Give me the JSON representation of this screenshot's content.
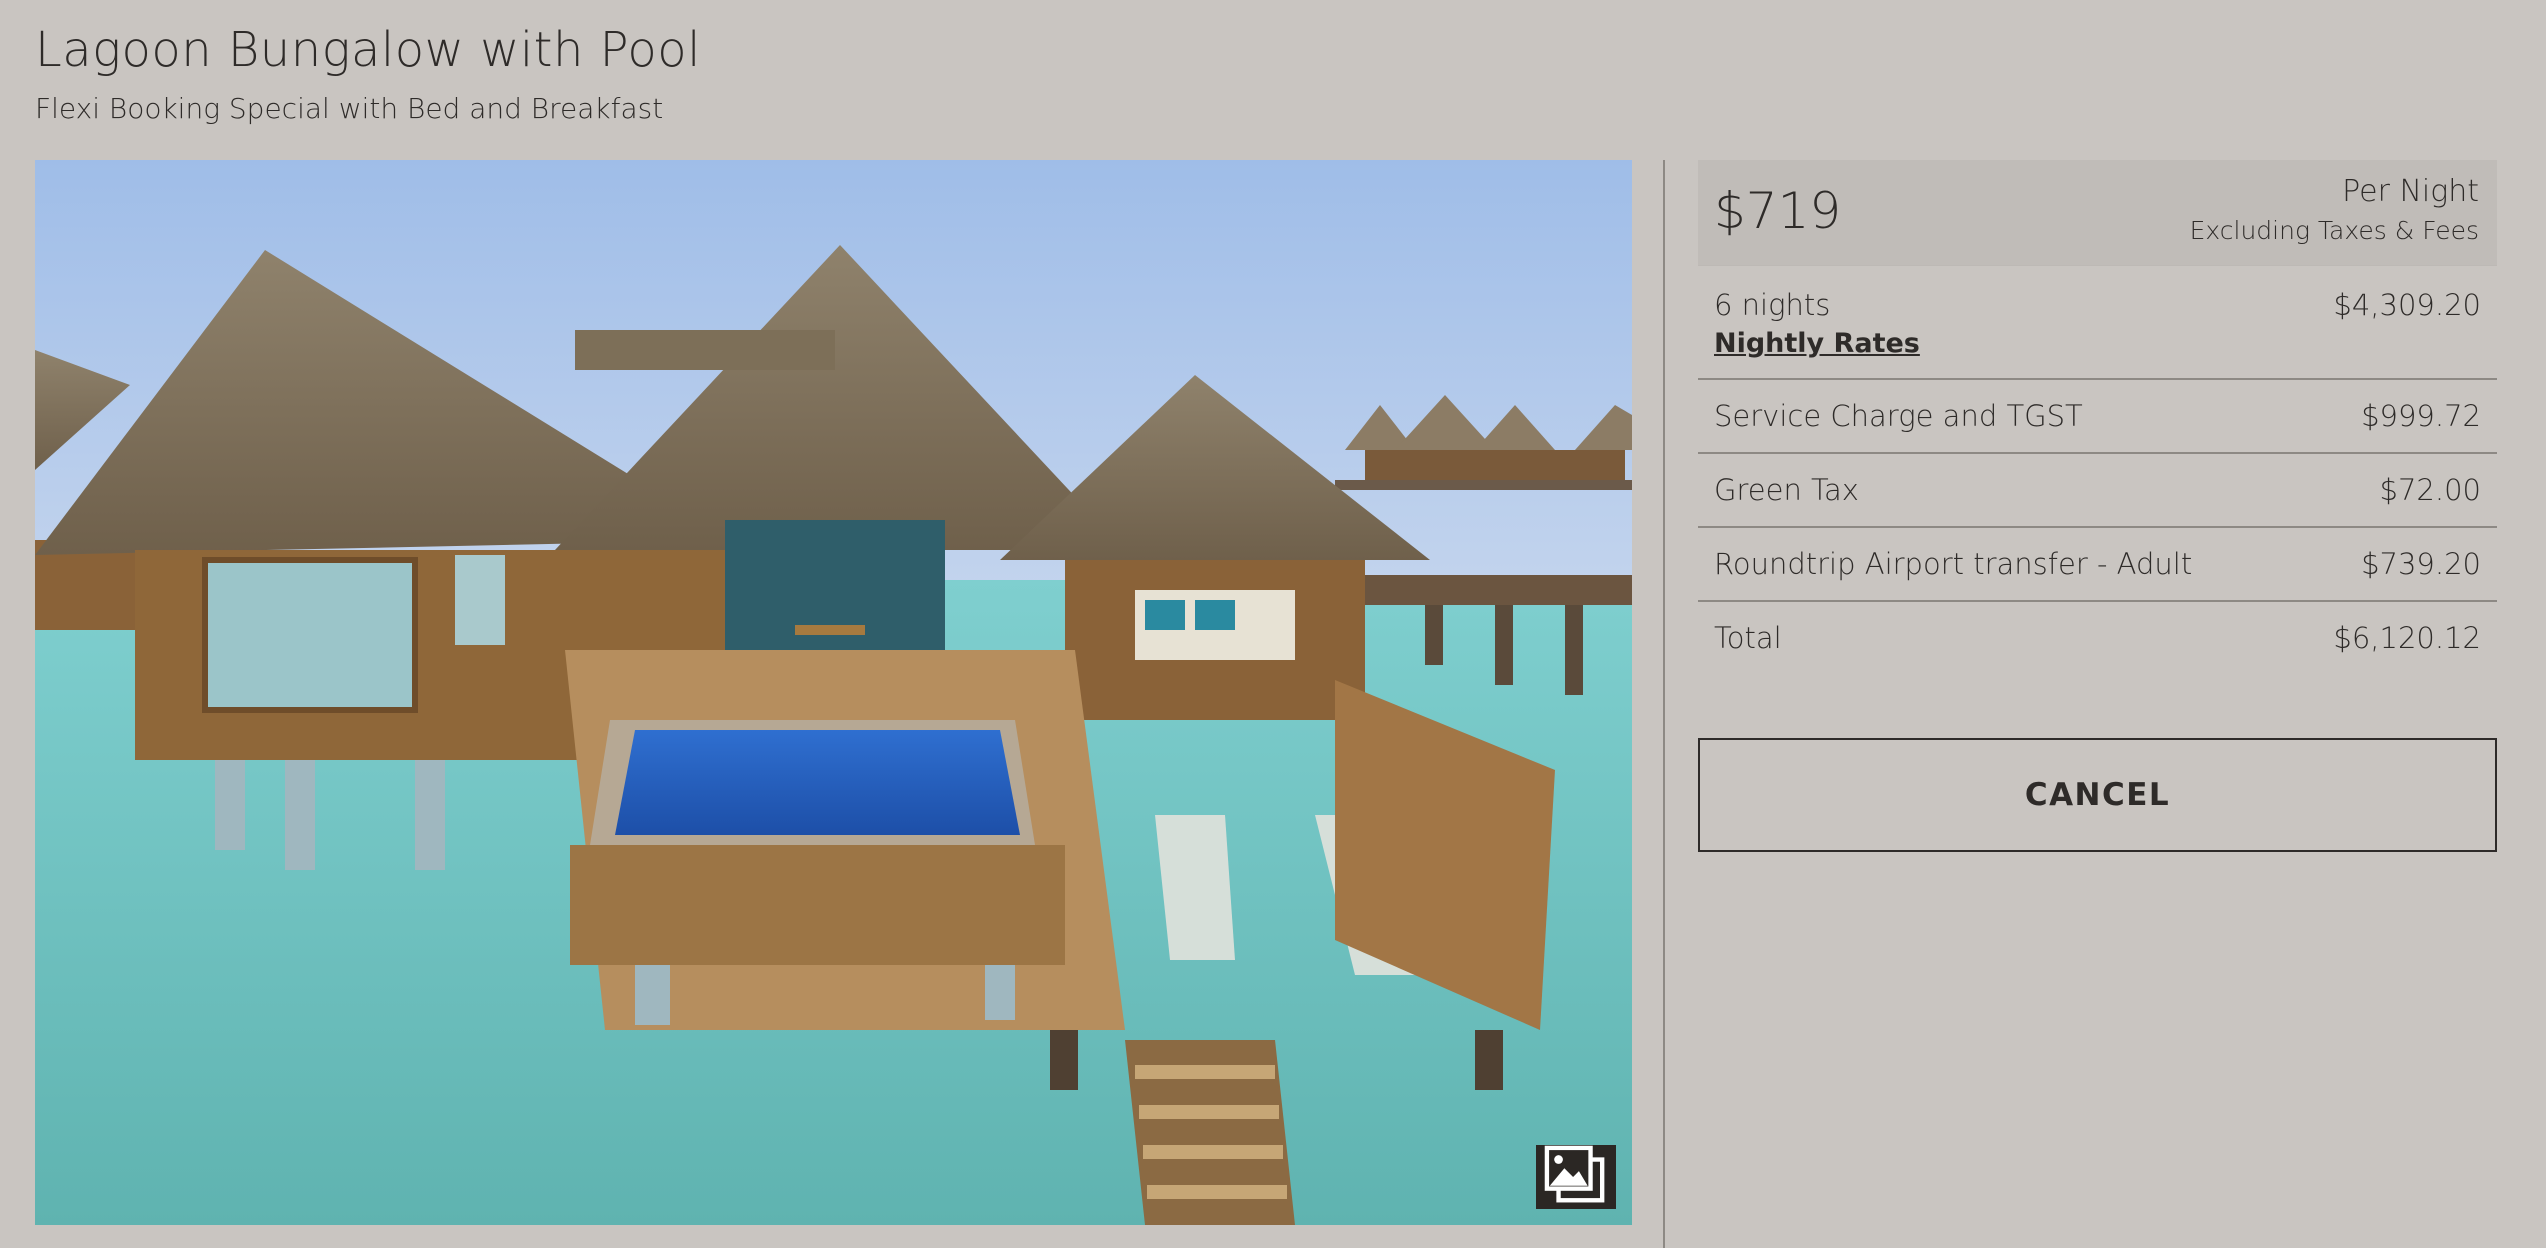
{
  "header": {
    "title": "Lagoon Bungalow with Pool",
    "subtitle": "Flexi Booking Special with Bed and Breakfast"
  },
  "photo": {
    "gallery_icon": "gallery-icon"
  },
  "price": {
    "amount": "$719",
    "per": "Per Night",
    "note": "Excluding Taxes & Fees"
  },
  "breakdown": {
    "nights_label": "6 nights",
    "nights_amount": "$4,309.20",
    "nightly_rates_link": "Nightly Rates",
    "items": [
      {
        "label": "Service Charge and TGST",
        "amount": "$999.72"
      },
      {
        "label": "Green Tax",
        "amount": "$72.00"
      },
      {
        "label": "Roundtrip Airport transfer - Adult",
        "amount": "$739.20"
      }
    ],
    "total_label": "Total",
    "total_amount": "$6,120.12"
  },
  "actions": {
    "cancel_label": "CANCEL"
  },
  "colors": {
    "background": "#c9c5c1",
    "text": "#2e2b29",
    "divider": "#8d8984",
    "gallery_button": "#2b2724"
  }
}
